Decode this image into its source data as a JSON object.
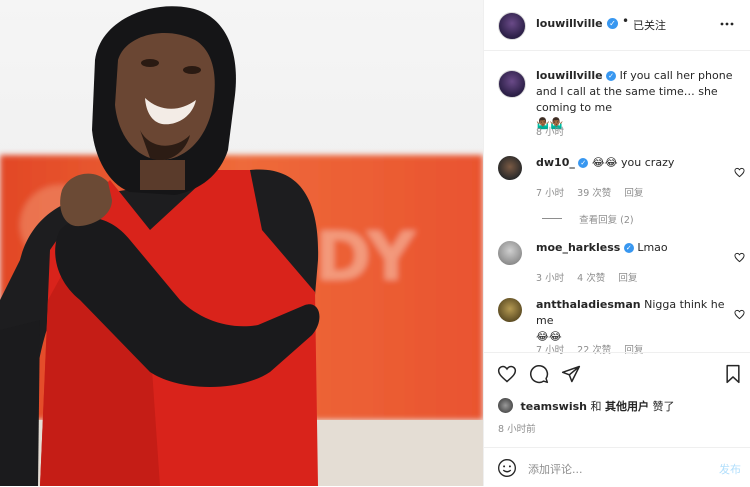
{
  "header": {
    "username": "louwillville",
    "follow_status": "已关注",
    "more_icon": "more-dots-icon"
  },
  "caption": {
    "username": "louwillville",
    "text": "If you call her phone and I call at the same time… she coming to me",
    "emoji": "🤷🏾‍♂️🤷🏾‍♂️",
    "time": "8 小时"
  },
  "comments": [
    {
      "username": "dw10_",
      "verified": true,
      "text": "😂😂 you crazy",
      "time": "7 小时",
      "likes": "39 次赞",
      "reply": "回复"
    },
    {
      "username": "moe_harkless",
      "verified": true,
      "text": "Lmao",
      "time": "3 小时",
      "likes": "4 次赞",
      "reply": "回复"
    },
    {
      "username": "antthaladiesman",
      "verified": false,
      "text": "Nigga think he me",
      "text2": "😂😂",
      "time": "7 小时",
      "likes": "22 次赞",
      "reply": "回复"
    }
  ],
  "view_replies": "查看回复 (2)",
  "likes": {
    "user": "teamswish",
    "joiner": "和",
    "others": "其他用户",
    "suffix": "赞了"
  },
  "post_time": "8 小时前",
  "composer": {
    "placeholder": "添加评论...",
    "post_button": "发布"
  },
  "colors": {
    "verified": "#3897f0",
    "jersey": "#e1261c",
    "banner": "#ea5a2e",
    "link": "#b2dffc"
  }
}
